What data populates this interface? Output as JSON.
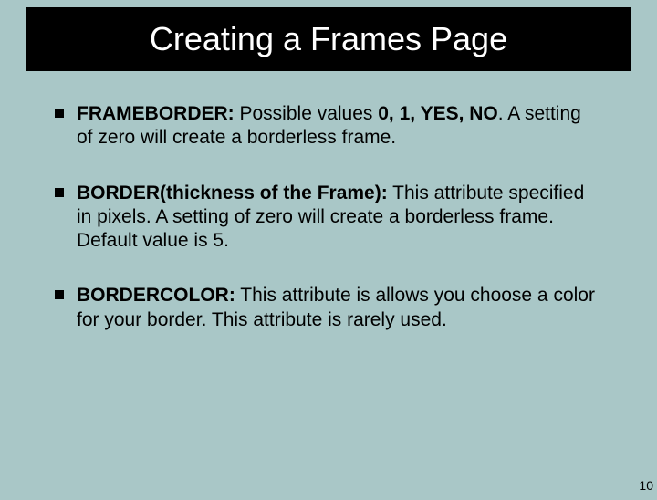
{
  "title": "Creating a Frames Page",
  "bullets": [
    {
      "label": "FRAMEBORDER: ",
      "prefix": "Possible values ",
      "bold_values": "0, 1, YES, NO",
      "rest": ". A setting of zero will create a borderless frame."
    },
    {
      "label": "BORDER(thickness of the Frame):",
      "rest": " This attribute specified in pixels. A setting of zero will create a borderless frame. Default value is 5."
    },
    {
      "label": "BORDERCOLOR:",
      "rest": " This attribute is allows you choose a color for your border. This attribute is rarely used."
    }
  ],
  "page_number": "10"
}
